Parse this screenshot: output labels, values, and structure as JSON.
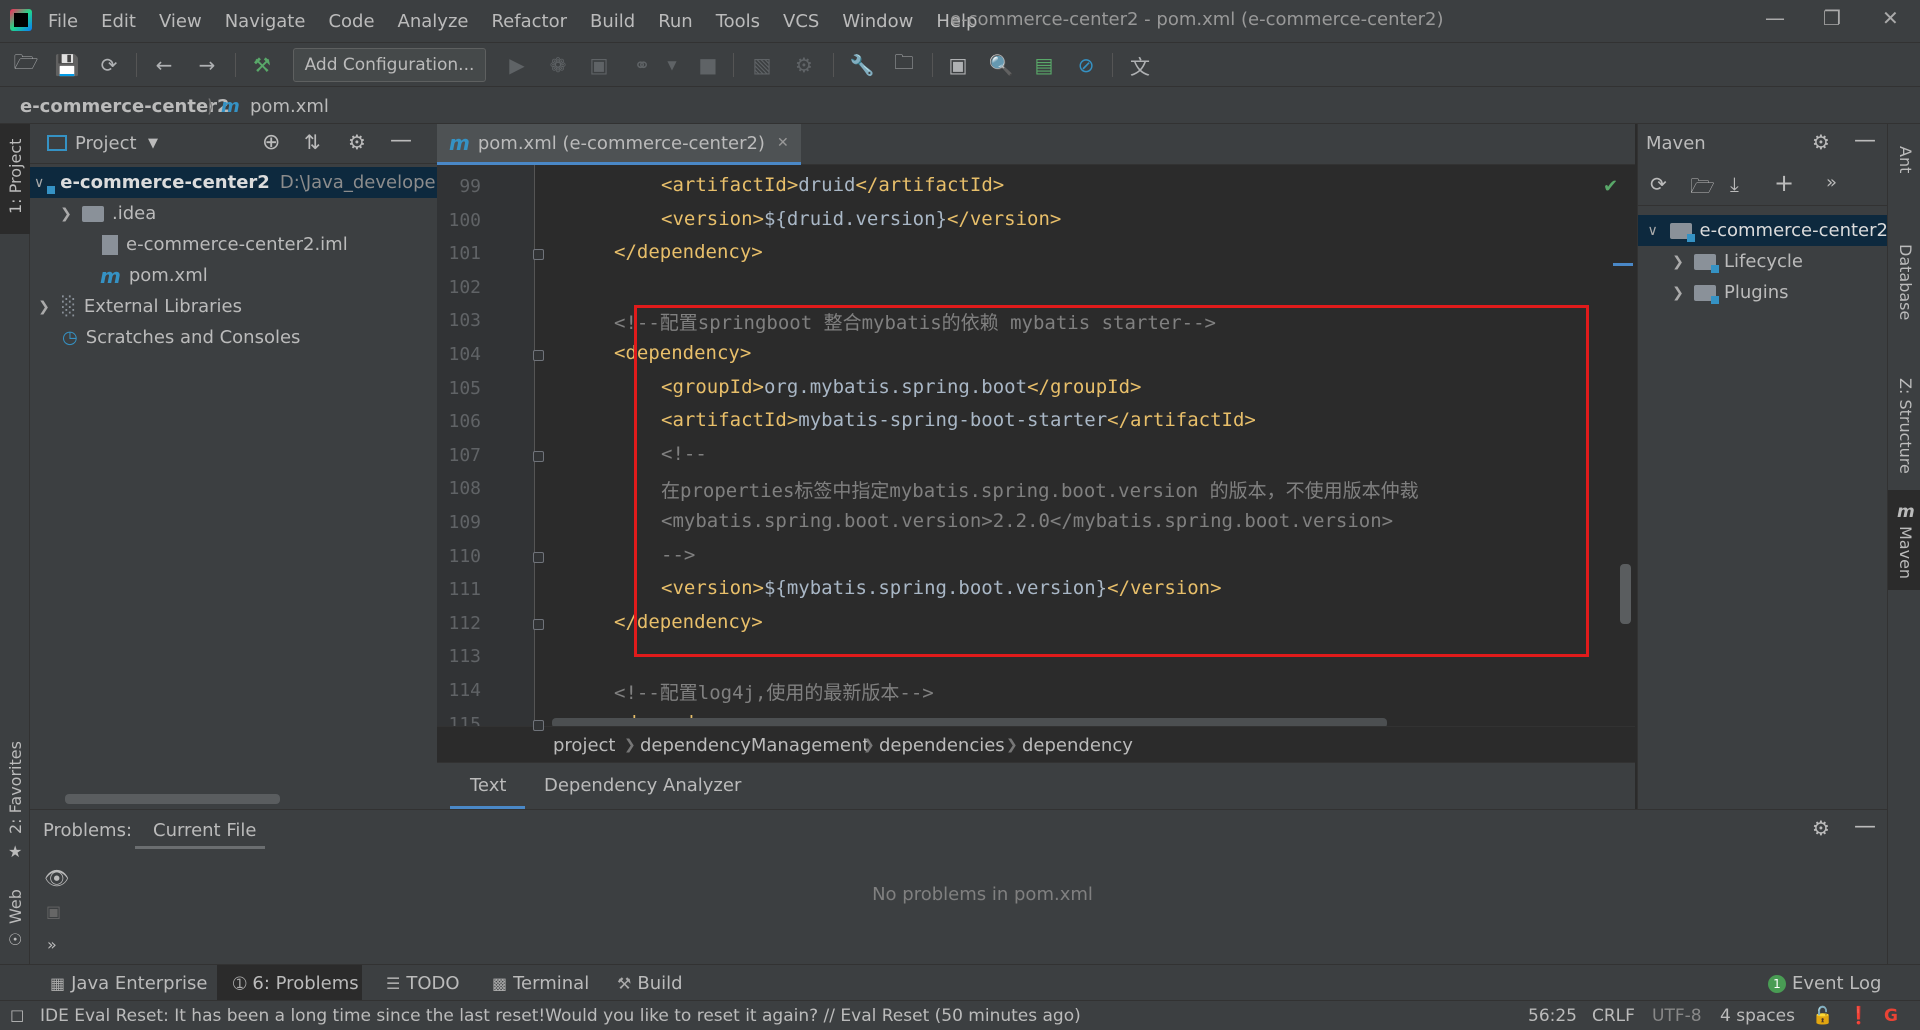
{
  "window": {
    "title": "e-commerce-center2 - pom.xml (e-commerce-center2)",
    "menu": [
      "File",
      "Edit",
      "View",
      "Navigate",
      "Code",
      "Analyze",
      "Refactor",
      "Build",
      "Run",
      "Tools",
      "VCS",
      "Window",
      "Help"
    ]
  },
  "toolbar": {
    "add_config_label": "Add Configuration..."
  },
  "navbar": {
    "project": "e-commerce-center2",
    "file": "pom.xml"
  },
  "left_stripe": {
    "project_tab": "1: Project",
    "favorites_tab": "2: Favorites",
    "web_tab": "Web"
  },
  "project_panel": {
    "title": "Project",
    "tree": [
      {
        "label": "e-commerce-center2",
        "path": "D:\\Java_developer",
        "kind": "module",
        "expanded": true
      },
      {
        "label": ".idea",
        "kind": "folder",
        "expanded": false
      },
      {
        "label": "e-commerce-center2.iml",
        "kind": "file"
      },
      {
        "label": "pom.xml",
        "kind": "maven-file"
      },
      {
        "label": "External Libraries",
        "kind": "libraries",
        "expanded": false
      },
      {
        "label": "Scratches and Consoles",
        "kind": "scratches"
      }
    ]
  },
  "editor": {
    "tab_label": "pom.xml (e-commerce-center2)",
    "lines": [
      {
        "n": "99",
        "indent": 2,
        "parts": [
          [
            "tag",
            "<artifactId>"
          ],
          [
            "txt",
            "druid"
          ],
          [
            "tag",
            "</artifactId>"
          ]
        ]
      },
      {
        "n": "100",
        "indent": 2,
        "parts": [
          [
            "tag",
            "<version>"
          ],
          [
            "txt",
            "${druid.version}"
          ],
          [
            "tag",
            "</version>"
          ]
        ]
      },
      {
        "n": "101",
        "indent": 1,
        "parts": [
          [
            "tag",
            "</dependency>"
          ]
        ]
      },
      {
        "n": "102",
        "indent": 0,
        "parts": []
      },
      {
        "n": "103",
        "indent": 1,
        "parts": [
          [
            "cmt",
            "<!--配置springboot 整合mybatis的依赖 mybatis starter-->"
          ]
        ]
      },
      {
        "n": "104",
        "indent": 1,
        "parts": [
          [
            "tag",
            "<dependency>"
          ]
        ]
      },
      {
        "n": "105",
        "indent": 2,
        "parts": [
          [
            "tag",
            "<groupId>"
          ],
          [
            "txt",
            "org.mybatis.spring.boot"
          ],
          [
            "tag",
            "</groupId>"
          ]
        ]
      },
      {
        "n": "106",
        "indent": 2,
        "parts": [
          [
            "tag",
            "<artifactId>"
          ],
          [
            "txt",
            "mybatis-spring-boot-starter"
          ],
          [
            "tag",
            "</artifactId>"
          ]
        ]
      },
      {
        "n": "107",
        "indent": 2,
        "parts": [
          [
            "cmt",
            "<!--"
          ]
        ]
      },
      {
        "n": "108",
        "indent": 2,
        "parts": [
          [
            "cmt",
            "在properties标签中指定mybatis.spring.boot.version 的版本，不使用版本仲裁"
          ]
        ]
      },
      {
        "n": "109",
        "indent": 2,
        "parts": [
          [
            "cmt",
            "<mybatis.spring.boot.version>2.2.0</mybatis.spring.boot.version>"
          ]
        ]
      },
      {
        "n": "110",
        "indent": 2,
        "parts": [
          [
            "cmt",
            "-->"
          ]
        ]
      },
      {
        "n": "111",
        "indent": 2,
        "parts": [
          [
            "tag",
            "<version>"
          ],
          [
            "txt",
            "${mybatis.spring.boot.version}"
          ],
          [
            "tag",
            "</version>"
          ]
        ]
      },
      {
        "n": "112",
        "indent": 1,
        "parts": [
          [
            "tag",
            "</dependency>"
          ]
        ]
      },
      {
        "n": "113",
        "indent": 0,
        "parts": []
      },
      {
        "n": "114",
        "indent": 1,
        "parts": [
          [
            "cmt",
            "<!--配置log4j,使用的最新版本-->"
          ]
        ]
      },
      {
        "n": "115",
        "indent": 1,
        "parts": [
          [
            "tag",
            "<dependency>"
          ]
        ]
      }
    ],
    "breadcrumb": [
      "project",
      "dependencyManagement",
      "dependencies",
      "dependency"
    ],
    "bottom_tabs": [
      "Text",
      "Dependency Analyzer"
    ]
  },
  "maven_panel": {
    "title": "Maven",
    "tree": [
      {
        "label": "e-commerce-center2",
        "expanded": true
      },
      {
        "label": "Lifecycle",
        "expanded": false
      },
      {
        "label": "Plugins",
        "expanded": false
      }
    ]
  },
  "right_stripe": {
    "tabs": [
      "Ant",
      "Database",
      "Z: Structure",
      "Maven"
    ]
  },
  "problems_panel": {
    "label": "Problems:",
    "tab": "Current File",
    "message": "No problems in pom.xml"
  },
  "tool_windows": [
    "Java Enterprise",
    "6: Problems",
    "TODO",
    "Terminal",
    "Build"
  ],
  "event_log": {
    "label": "Event Log",
    "count": "1"
  },
  "status": {
    "message": "IDE Eval Reset: It has been a long time since the last reset!Would you like to reset it again? // Eval Reset (50 minutes ago)",
    "position": "56:25",
    "line_sep": "CRLF",
    "encoding": "UTF-8",
    "indent": "4 spaces"
  },
  "colors": {
    "tag": "#e8bf6a",
    "text": "#a9b7c6",
    "comment": "#808080",
    "highlight_box": "#e01b1b",
    "accent": "#4a88c7"
  }
}
